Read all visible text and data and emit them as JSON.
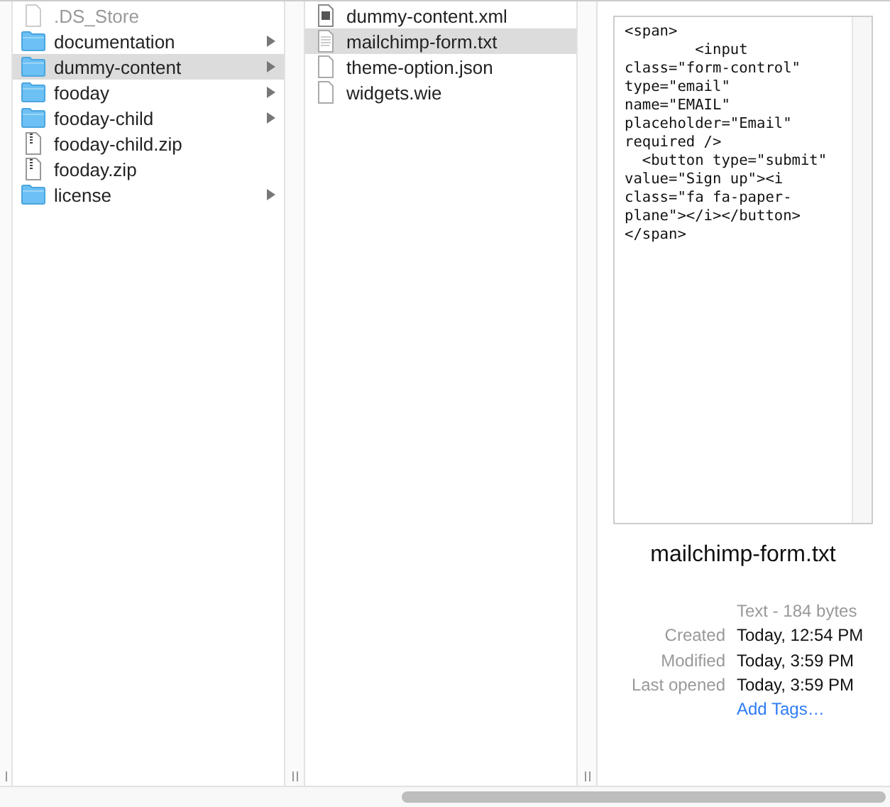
{
  "columns": [
    {
      "items": [
        {
          "name": ".DS_Store",
          "kind": "file",
          "hidden": true,
          "selected": false,
          "has_children": false
        },
        {
          "name": "documentation",
          "kind": "folder",
          "hidden": false,
          "selected": false,
          "has_children": true
        },
        {
          "name": "dummy-content",
          "kind": "folder",
          "hidden": false,
          "selected": true,
          "has_children": true
        },
        {
          "name": "fooday",
          "kind": "folder",
          "hidden": false,
          "selected": false,
          "has_children": true
        },
        {
          "name": "fooday-child",
          "kind": "folder",
          "hidden": false,
          "selected": false,
          "has_children": true
        },
        {
          "name": "fooday-child.zip",
          "kind": "archive",
          "hidden": false,
          "selected": false,
          "has_children": false
        },
        {
          "name": "fooday.zip",
          "kind": "archive",
          "hidden": false,
          "selected": false,
          "has_children": false
        },
        {
          "name": "license",
          "kind": "folder",
          "hidden": false,
          "selected": false,
          "has_children": true
        }
      ]
    },
    {
      "items": [
        {
          "name": "dummy-content.xml",
          "kind": "xml",
          "hidden": false,
          "selected": false,
          "has_children": false
        },
        {
          "name": "mailchimp-form.txt",
          "kind": "text",
          "hidden": false,
          "selected": true,
          "has_children": false
        },
        {
          "name": "theme-option.json",
          "kind": "file",
          "hidden": false,
          "selected": false,
          "has_children": false
        },
        {
          "name": "widgets.wie",
          "kind": "file",
          "hidden": false,
          "selected": false,
          "has_children": false
        }
      ]
    }
  ],
  "preview": {
    "content_lines": [
      "<span>",
      "        <input",
      "class=\"form-control\"",
      "type=\"email\"",
      "name=\"EMAIL\"",
      "placeholder=\"Email\"",
      "required />",
      "  <button type=\"submit\"",
      "value=\"Sign up\"><i",
      "class=\"fa fa-paper-",
      "plane\"></i></button>",
      "</span>"
    ],
    "file_name": "mailchimp-form.txt",
    "kind_size": "Text - 184 bytes",
    "details": [
      {
        "label": "Created",
        "value": "Today, 12:54 PM"
      },
      {
        "label": "Modified",
        "value": "Today, 3:59 PM"
      },
      {
        "label": "Last opened",
        "value": "Today, 3:59 PM"
      }
    ],
    "tags_link": "Add Tags…"
  }
}
